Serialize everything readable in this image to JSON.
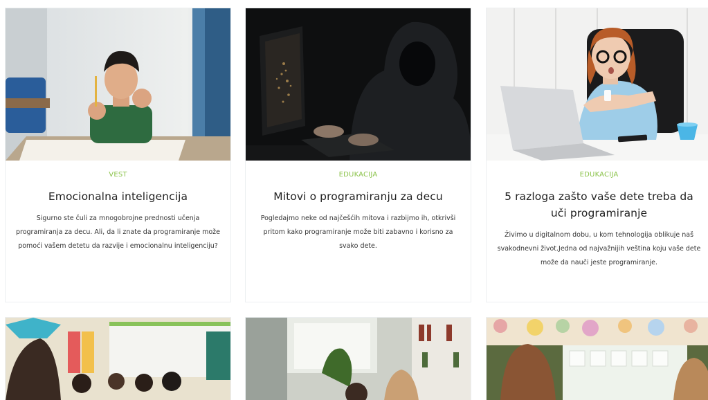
{
  "cards": [
    {
      "category": "VEST",
      "title": "Emocionalna inteligencija",
      "excerpt": "Sigurno ste čuli za mnogobrojne prednosti učenja programiranja za decu. Ali, da li znate da programiranje može pomoći vašem detetu da razvije i emocionalnu inteligenciju?",
      "image": "boy-frustrated-at-desk-photo"
    },
    {
      "category": "EDUKACIJA",
      "title": "Mitovi o programiranju za decu",
      "excerpt": "Pogledajmo neke od najčešćih mitova i razbijmo ih, otkrivši pritom kako programiranje može biti zabavno i korisno za svako dete.",
      "image": "hooded-hacker-at-computer-photo"
    },
    {
      "category": "EDUKACIJA",
      "title": "5 razloga zašto vaše dete treba da uči programiranje",
      "excerpt": "Živimo u digitalnom dobu, u kom tehnologija oblikuje naš svakodnevni život.Jedna od najvažnijih veština koju vaše dete može da nauči jeste programiranje.",
      "image": "girl-with-glasses-checking-watch-photo"
    }
  ],
  "bottom_cards": [
    {
      "image": "classroom-children-photo"
    },
    {
      "image": "children-in-library-photo"
    },
    {
      "image": "girl-at-classroom-board-photo"
    }
  ]
}
